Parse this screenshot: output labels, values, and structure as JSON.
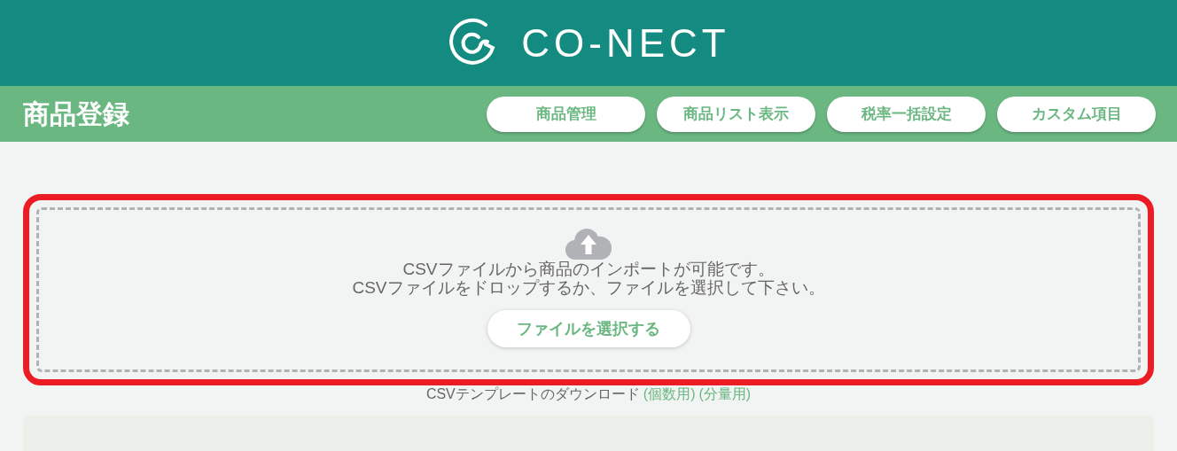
{
  "header": {
    "brand": "CO-NECT"
  },
  "toolbar": {
    "title": "商品登録",
    "buttons": [
      "商品管理",
      "商品リスト表示",
      "税率一括設定",
      "カスタム項目"
    ]
  },
  "upload": {
    "lines": [
      "CSVファイルから商品のインポートが可能です。",
      "CSVファイルをドロップするか、ファイルを選択して下さい。"
    ],
    "button": "ファイルを選択する"
  },
  "template": {
    "label": "CSVテンプレートのダウンロード",
    "links": [
      "(個数用)",
      "(分量用)"
    ]
  }
}
